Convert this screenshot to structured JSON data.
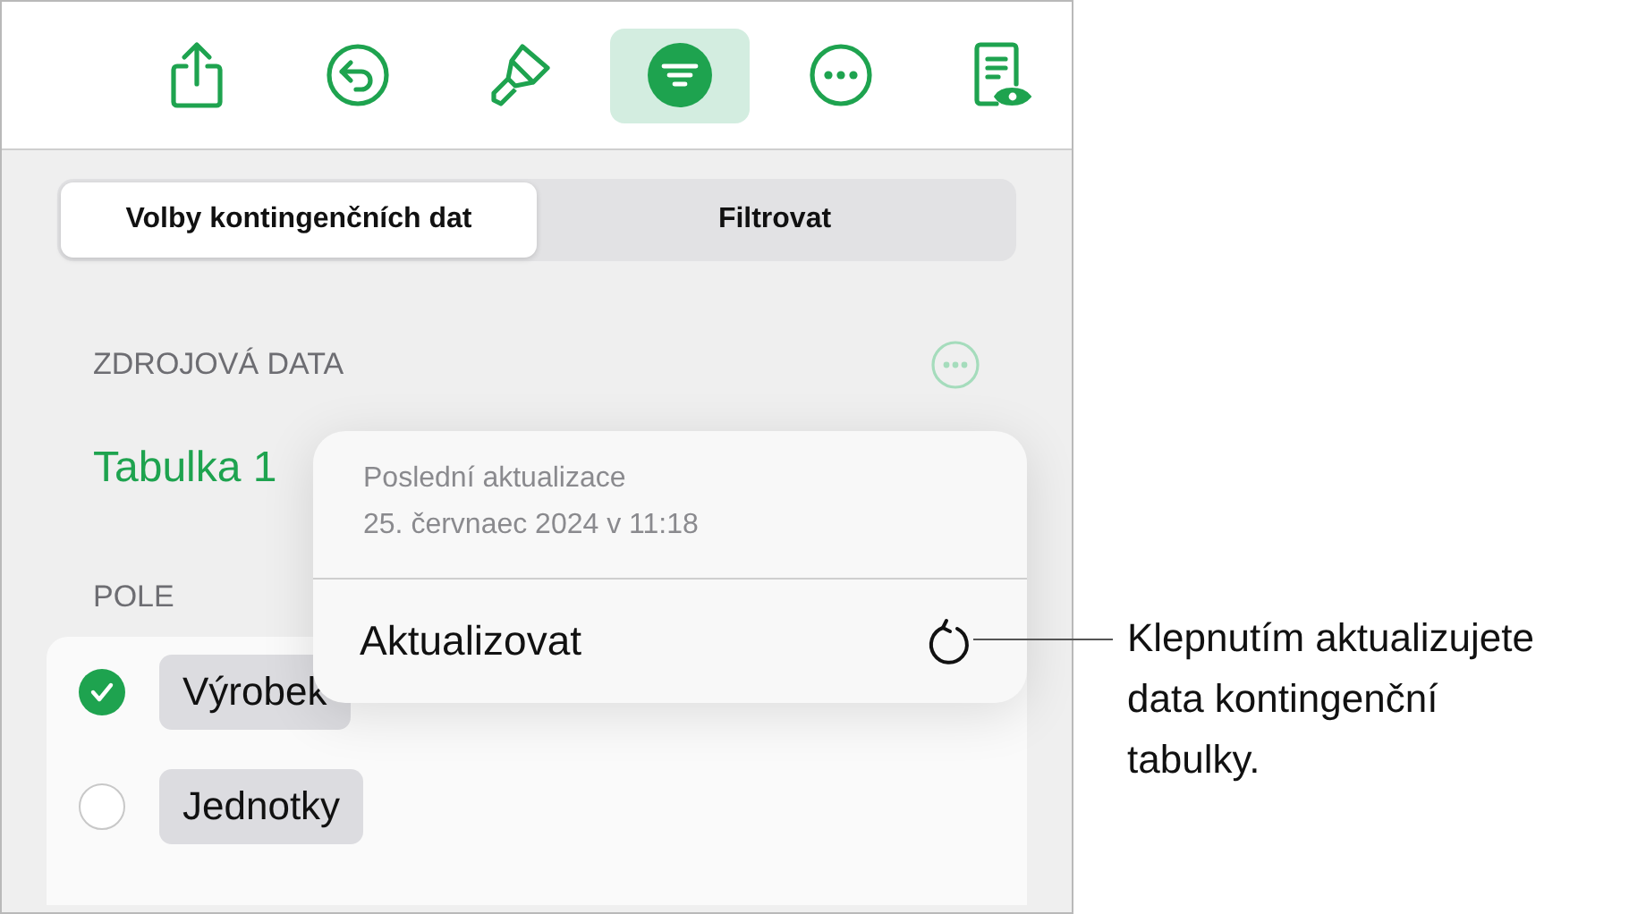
{
  "toolbar": [
    {
      "kind": "share",
      "selected": false
    },
    {
      "kind": "undo",
      "selected": false
    },
    {
      "kind": "brush",
      "selected": false
    },
    {
      "kind": "filter",
      "selected": true
    },
    {
      "kind": "more",
      "selected": false
    },
    {
      "kind": "preview",
      "selected": false
    }
  ],
  "segments": [
    {
      "label": "Volby kontingenčních dat",
      "selected": true
    },
    {
      "label": "Filtrovat",
      "selected": false
    }
  ],
  "source_section": {
    "title": "ZDROJOVÁ DATA",
    "table": "Tabulka 1"
  },
  "fields_section": {
    "title": "POLE",
    "fields": [
      {
        "label": "Výrobek",
        "checked": true
      },
      {
        "label": "Jednotky",
        "checked": false
      }
    ]
  },
  "popover": {
    "caption": "Poslední aktualizace",
    "date": "25. červnaec 2024 v 11:18",
    "action": "Aktualizovat"
  },
  "callout": "Klepnutím aktualizujete data kontingenční tabulky."
}
